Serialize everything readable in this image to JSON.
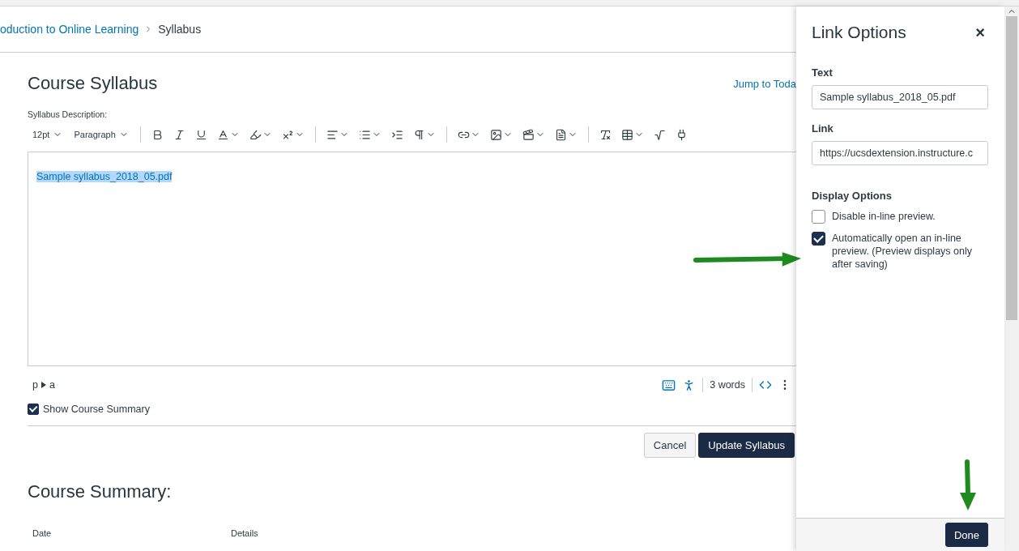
{
  "breadcrumb": {
    "items": [
      {
        "label": "oduction to Online Learning",
        "kind": "link"
      },
      {
        "label": "Syllabus",
        "kind": "current"
      }
    ]
  },
  "page": {
    "title": "Course Syllabus",
    "jump_link": "Jump to Toda"
  },
  "editor": {
    "label": "Syllabus Description:",
    "font_size": "12pt",
    "block_format": "Paragraph",
    "content": "Sample syllabus_2018_05.pdf",
    "content_selected": true,
    "path": [
      "p",
      "a"
    ],
    "word_count": "3 words"
  },
  "show_course_summary": {
    "label": "Show Course Summary",
    "checked": true
  },
  "buttons": [
    {
      "label": "Cancel",
      "kind": "secondary"
    },
    {
      "label": "Update Syllabus",
      "kind": "primary"
    }
  ],
  "summary": {
    "title": "Course Summary:",
    "columns": [
      "Date",
      "Details"
    ]
  },
  "link_options": {
    "title": "Link Options",
    "close": "×",
    "text_label": "Text",
    "text_value": "Sample syllabus_2018_05.pdf",
    "link_label": "Link",
    "link_value": "https://ucsdextension.instructure.c",
    "display_title": "Display Options",
    "options": [
      {
        "label": "Disable in-line preview.",
        "checked": false
      },
      {
        "label": "Automatically open an in-line preview. (Preview displays only after saving)",
        "checked": true
      }
    ],
    "done": "Done"
  }
}
